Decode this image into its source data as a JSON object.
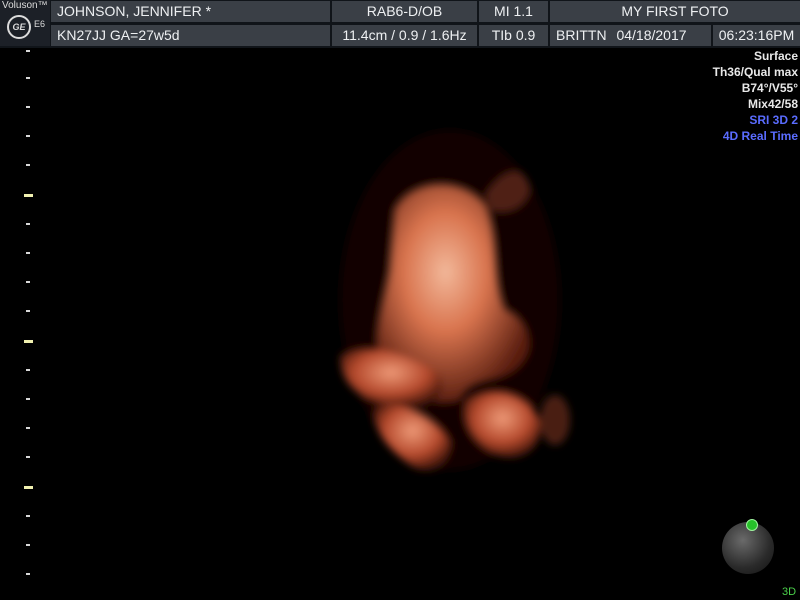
{
  "logo": {
    "brand": "Voluson™",
    "badge": "GE",
    "model": "E6"
  },
  "header": {
    "patient_name": "JOHNSON, JENNIFER  *",
    "probe": "RAB6-D/OB",
    "mi": "MI  1.1",
    "title": "MY FIRST FOTO",
    "patient_id": "KN27JJ  GA=27w5d",
    "depth": "11.4cm / 0.9 / 1.6Hz",
    "tib": "TIb  0.9",
    "operator": "BRITTN",
    "date": "04/18/2017",
    "time": "06:23:16PM"
  },
  "parameters": {
    "render": "Surface",
    "threshold": "Th36/Qual max",
    "angle": "B74°/V55°",
    "mix": "Mix42/58",
    "sri": "SRI 3D 2",
    "realtime": "4D Real Time"
  },
  "indicators": {
    "mode": "3D"
  },
  "colors": {
    "header_bg": "#3a3f46",
    "accent_blue": "#5a6cff",
    "orientation_green": "#27c12a"
  }
}
